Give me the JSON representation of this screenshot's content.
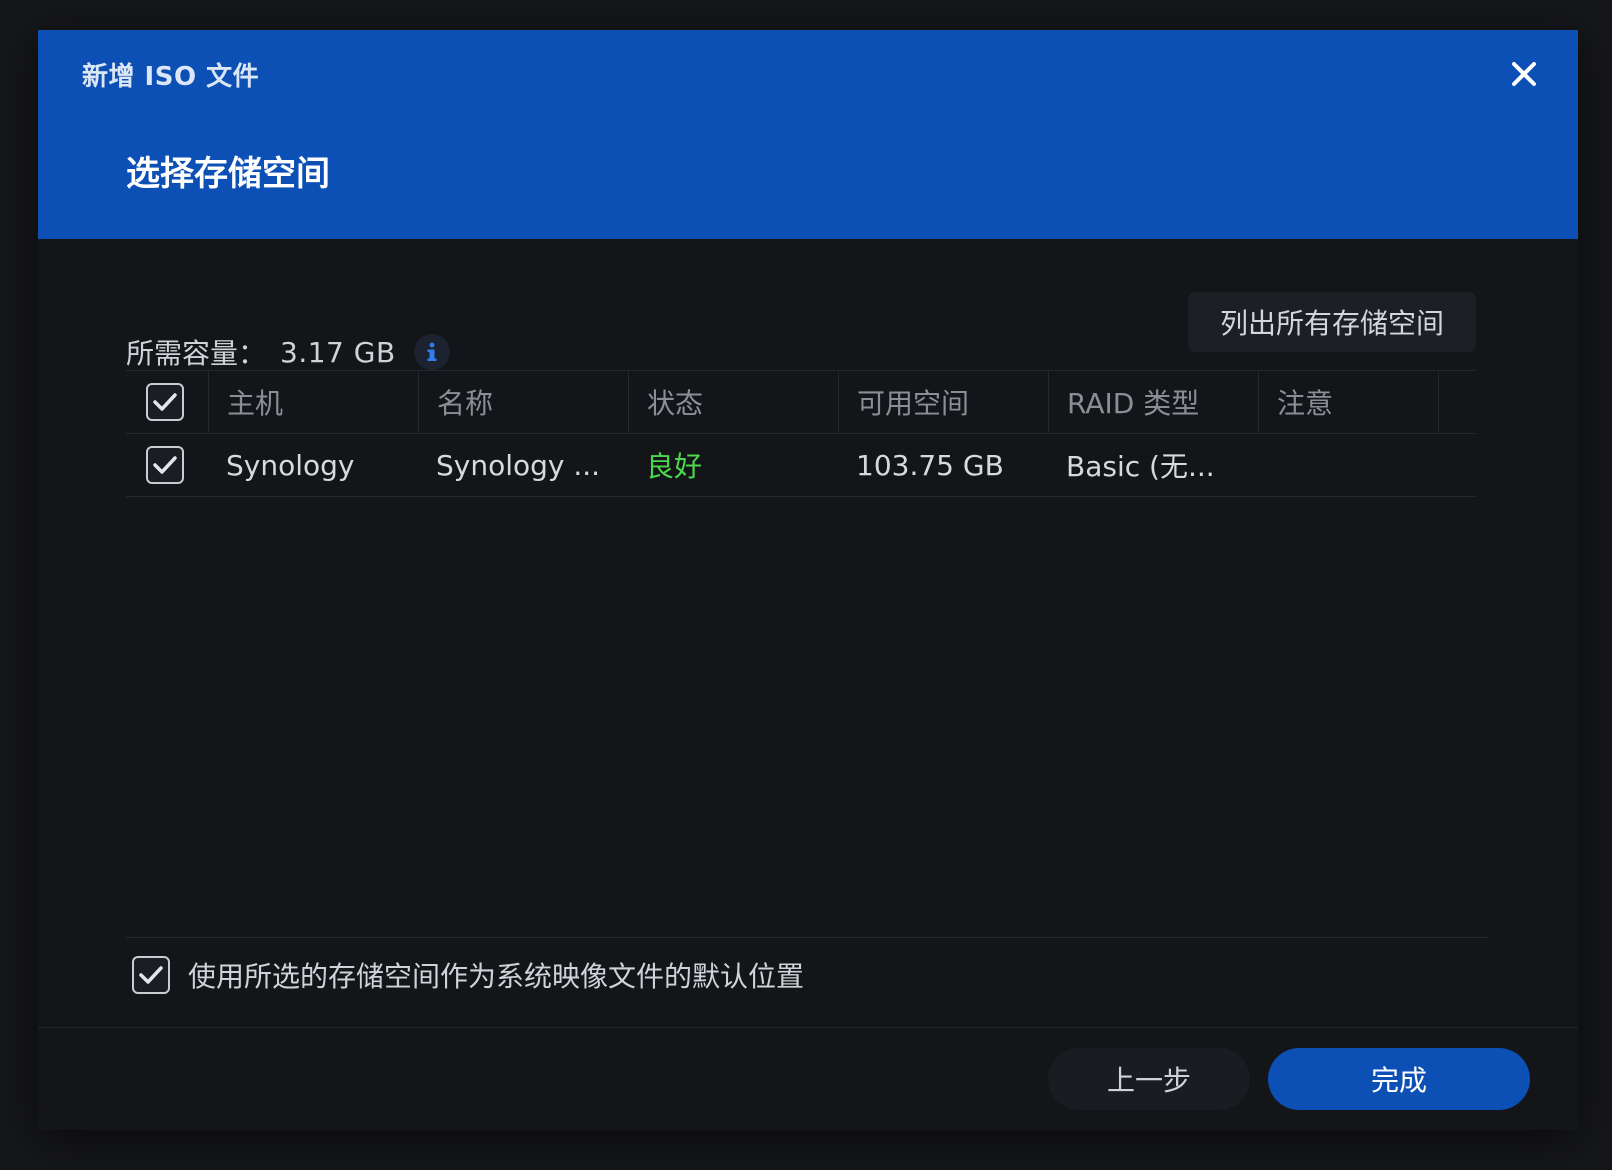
{
  "dialog": {
    "window_title": "新增 ISO 文件",
    "step_title": "选择存储空间",
    "close_icon": "close-icon"
  },
  "capacity": {
    "label": "所需容量：",
    "value": "3.17 GB",
    "info_icon": "info-icon"
  },
  "toolbar": {
    "list_all_label": "列出所有存储空间"
  },
  "table": {
    "columns": [
      "主机",
      "名称",
      "状态",
      "可用空间",
      "RAID 类型",
      "注意"
    ],
    "header_checked": true,
    "rows": [
      {
        "checked": true,
        "host": "Synology",
        "name": "Synology ...",
        "status": "良好",
        "free": "103.75 GB",
        "raid": "Basic (无...",
        "note": ""
      }
    ]
  },
  "default_option": {
    "checked": true,
    "label": "使用所选的存储空间作为系统映像文件的默认位置"
  },
  "footer": {
    "back_label": "上一步",
    "finish_label": "完成"
  },
  "colors": {
    "header_bg": "#0c4fb5",
    "dialog_bg": "#141519",
    "status_good": "#4cd84c",
    "primary_button": "#0c4fb5"
  }
}
